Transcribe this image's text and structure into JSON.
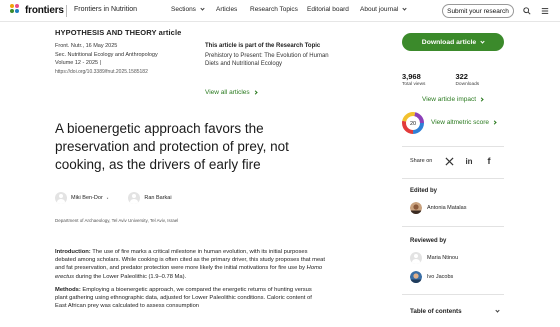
{
  "topbar": {
    "logo_text": "frontiers",
    "journal": "Frontiers in Nutrition",
    "nav": [
      {
        "label": "Sections",
        "has_dropdown": true
      },
      {
        "label": "Articles",
        "has_dropdown": false
      },
      {
        "label": "Research Topics",
        "has_dropdown": false
      },
      {
        "label": "Editorial board",
        "has_dropdown": false
      },
      {
        "label": "About journal",
        "has_dropdown": true
      }
    ],
    "submit_label": "Submit your research",
    "icons": [
      "search-icon",
      "menu-icon"
    ]
  },
  "article": {
    "type": "HYPOTHESIS AND THEORY article",
    "meta": {
      "line1": "Front. Nutr., 16 May 2025",
      "line2": "Sec. Nutritional Ecology and Anthropology",
      "line3": "Volume 12 - 2025 |",
      "doi": "https://doi.org/10.3389/fnut.2025.1585182"
    },
    "research_topic": {
      "heading": "This article is part of the Research Topic",
      "name": "Prehistory to Present: The Evolution of Human Diets and Nutritional Ecology",
      "view_all": "View all articles"
    },
    "title": "A bioenergetic approach favors the preservation and protection of prey, not cooking, as the drivers of early fire",
    "authors": [
      {
        "name": "Miki Ben-Dor",
        "sup": "*"
      },
      {
        "name": "Ran Barkai",
        "sup": ""
      }
    ],
    "affiliation": "Department of Archaeology, Tel Aviv University, Tel Aviv, Israel",
    "abstract": {
      "intro_label": "Introduction:",
      "intro_text_1": " The use of fire marks a critical milestone in human evolution, with its initial purposes debated among scholars. While cooking is often cited as the primary driver, this study proposes that meat and fat preservation, and predator protection were more likely the initial motivations for fire use by ",
      "intro_italic": "Homo erectus",
      "intro_text_2": " during the Lower Paleolithic (1.9–0.78 Ma).",
      "methods_label": "Methods:",
      "methods_text": " Employing a bioenergetic approach, we compared the energetic returns of hunting versus plant gathering using ethnographic data, adjusted for Lower Paleolithic conditions. Caloric content of East African prey was calculated to assess consumption"
    }
  },
  "sidebar": {
    "download_label": "Download article",
    "stats": [
      {
        "value": "3,968",
        "label": "Total views"
      },
      {
        "value": "322",
        "label": "Downloads"
      }
    ],
    "impact_label": "View article impact",
    "altmetric_score": "20",
    "altmetric_label": "View altmetric score",
    "share_label": "Share on",
    "share_icons": [
      "x-icon",
      "linkedin-icon",
      "facebook-icon"
    ],
    "edited_by_label": "Edited by",
    "editor": "Antonia Matalas",
    "reviewed_by_label": "Reviewed by",
    "reviewers": [
      "Maria Ntinou",
      "Ivo Jacobs"
    ],
    "toc_label": "Table of contents"
  },
  "colors": {
    "accent_green": "#3b8a2b",
    "link_green": "#2a7a1f"
  }
}
